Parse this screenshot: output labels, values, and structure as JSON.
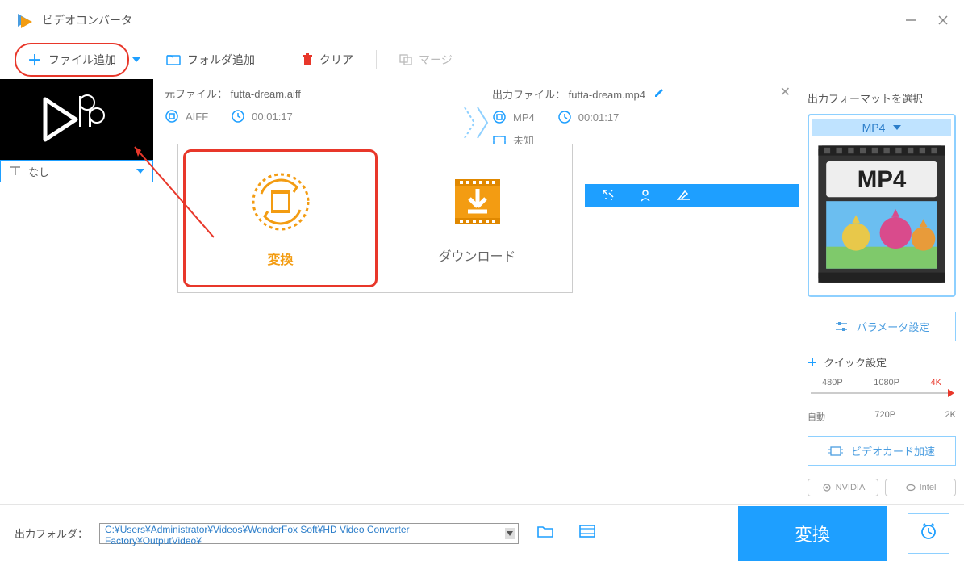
{
  "app": {
    "title": "ビデオコンバータ"
  },
  "toolbar": {
    "add_file": "ファイル追加",
    "add_folder": "フォルダ追加",
    "clear": "クリア",
    "merge": "マージ"
  },
  "file": {
    "source_label": "元ファイル：",
    "source_name": "futta-dream.aiff",
    "output_label": "出力ファイル：",
    "output_name": "futta-dream.mp4",
    "src_format": "AIFF",
    "src_duration": "00:01:17",
    "dst_format": "MP4",
    "dst_duration": "00:01:17",
    "resolution": "未知"
  },
  "subtitle": {
    "selected": "なし"
  },
  "modal": {
    "convert": "変換",
    "download": "ダウンロード"
  },
  "sidebar": {
    "title": "出力フォーマットを選択",
    "format": "MP4",
    "format_badge": "MP4",
    "param_btn": "パラメータ設定",
    "quick_title": "クイック設定",
    "gpu_btn": "ビデオカード加速",
    "nvidia": "NVIDIA",
    "intel": "Intel",
    "quality_top": [
      "480P",
      "1080P",
      "4K"
    ],
    "quality_bottom": [
      "自動",
      "720P",
      "2K"
    ]
  },
  "bottom": {
    "label": "出力フォルダ：",
    "path": "C:¥Users¥Administrator¥Videos¥WonderFox Soft¥HD Video Converter Factory¥OutputVideo¥",
    "convert": "変換"
  }
}
